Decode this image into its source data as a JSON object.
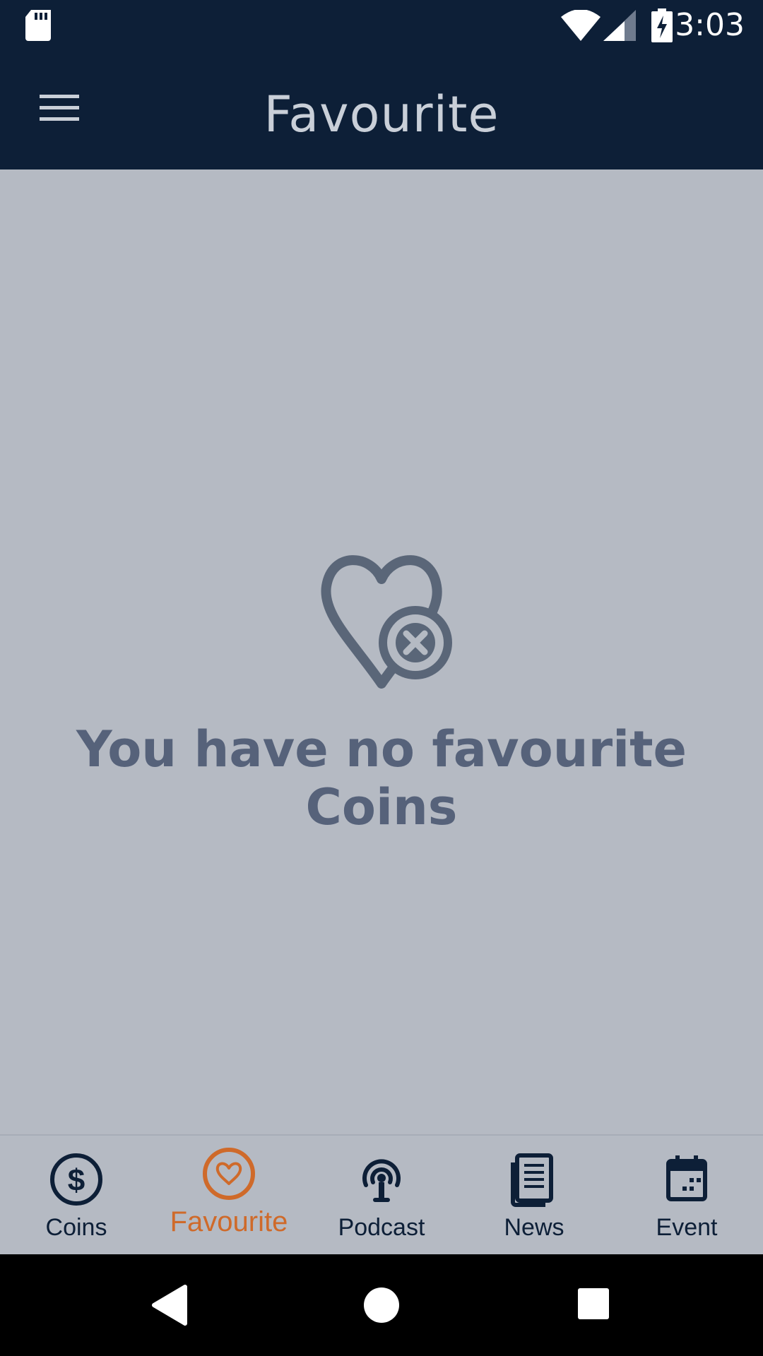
{
  "status_bar": {
    "time": "3:03",
    "icons": [
      "sd-card-icon",
      "wifi-icon",
      "cell-signal-icon",
      "battery-charging-icon"
    ]
  },
  "app_bar": {
    "title": "Favourite",
    "menu_icon": "hamburger-menu-icon"
  },
  "empty_state": {
    "icon": "heart-remove-icon",
    "message": "You have no favourite Coins"
  },
  "bottom_nav": {
    "items": [
      {
        "label": "Coins",
        "icon": "dollar-coin-icon",
        "active": false
      },
      {
        "label": "Favourite",
        "icon": "heart-circle-icon",
        "active": true
      },
      {
        "label": "Podcast",
        "icon": "podcast-icon",
        "active": false
      },
      {
        "label": "News",
        "icon": "newspaper-icon",
        "active": false
      },
      {
        "label": "Event",
        "icon": "calendar-icon",
        "active": false
      }
    ]
  },
  "system_nav": {
    "buttons": [
      "back-icon",
      "home-icon",
      "recents-icon"
    ]
  },
  "colors": {
    "app_bar": "#0d1f37",
    "background": "#b5bac3",
    "accent": "#cf6a2a",
    "empty_text": "#56627a"
  }
}
